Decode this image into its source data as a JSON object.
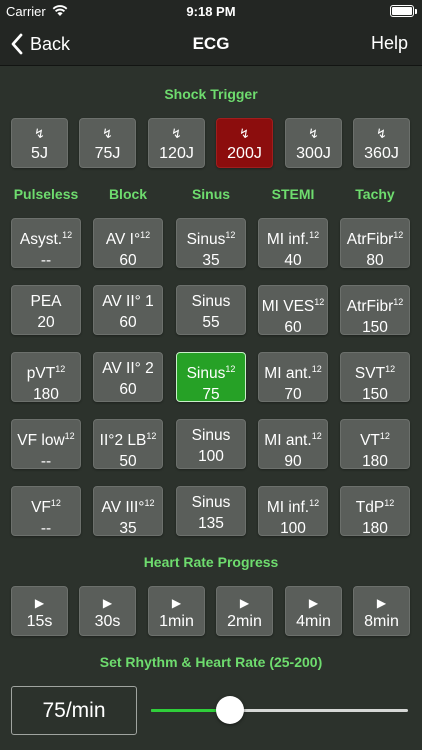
{
  "status_bar": {
    "carrier": "Carrier",
    "time": "9:18 PM"
  },
  "nav": {
    "back_label": "Back",
    "title": "ECG",
    "help_label": "Help"
  },
  "shock": {
    "title": "Shock Trigger",
    "symbol": "↯",
    "buttons": [
      "5J",
      "75J",
      "120J",
      "200J",
      "300J",
      "360J"
    ],
    "selected": "200J"
  },
  "columns": [
    "Pulseless",
    "Block",
    "Sinus",
    "STEMI",
    "Tachy"
  ],
  "rhythms": [
    [
      {
        "label": "Asyst.",
        "sup": "12",
        "rate": "--"
      },
      {
        "label": "AV I°",
        "sup": "12",
        "rate": "60"
      },
      {
        "label": "Sinus",
        "sup": "12",
        "rate": "35"
      },
      {
        "label": "MI inf.",
        "sup": "12",
        "rate": "40"
      },
      {
        "label": "AtrFibr",
        "sup": "12",
        "rate": "80"
      }
    ],
    [
      {
        "label": "PEA",
        "sup": "",
        "rate": "20"
      },
      {
        "label": "AV II° 1",
        "sup": "",
        "rate": "60"
      },
      {
        "label": "Sinus",
        "sup": "",
        "rate": "55"
      },
      {
        "label": "MI VES",
        "sup": "12",
        "rate": "60"
      },
      {
        "label": "AtrFibr",
        "sup": "12",
        "rate": "150"
      }
    ],
    [
      {
        "label": "pVT",
        "sup": "12",
        "rate": "180"
      },
      {
        "label": "AV II° 2",
        "sup": "",
        "rate": "60"
      },
      {
        "label": "Sinus",
        "sup": "12",
        "rate": "75"
      },
      {
        "label": "MI ant.",
        "sup": "12",
        "rate": "70"
      },
      {
        "label": "SVT",
        "sup": "12",
        "rate": "150"
      }
    ],
    [
      {
        "label": "VF low",
        "sup": "12",
        "rate": "--"
      },
      {
        "label": "II°2 LB",
        "sup": "12",
        "rate": "50"
      },
      {
        "label": "Sinus",
        "sup": "",
        "rate": "100"
      },
      {
        "label": "MI ant.",
        "sup": "12",
        "rate": "90"
      },
      {
        "label": "VT",
        "sup": "12",
        "rate": "180"
      }
    ],
    [
      {
        "label": "VF",
        "sup": "12",
        "rate": "--"
      },
      {
        "label": "AV III°",
        "sup": "12",
        "rate": "35"
      },
      {
        "label": "Sinus",
        "sup": "",
        "rate": "135"
      },
      {
        "label": "MI inf.",
        "sup": "12",
        "rate": "100"
      },
      {
        "label": "TdP",
        "sup": "12",
        "rate": "180"
      }
    ]
  ],
  "selected_rhythm": {
    "row": 2,
    "col": 2
  },
  "progress": {
    "title": "Heart Rate Progress",
    "symbol": "▶",
    "buttons": [
      "15s",
      "30s",
      "1min",
      "2min",
      "4min",
      "8min"
    ]
  },
  "rate": {
    "title": "Set Rhythm & Heart Rate (25-200)",
    "value_label": "75/min",
    "min": 25,
    "max": 200,
    "value": 75
  },
  "colors": {
    "accent_green": "#6edc6e",
    "selected_red": "#8c0d0d",
    "selected_green": "#26a126",
    "button_gray": "#5a5e5a",
    "background": "#2c322c",
    "slider_fill": "#2fcf3a"
  }
}
